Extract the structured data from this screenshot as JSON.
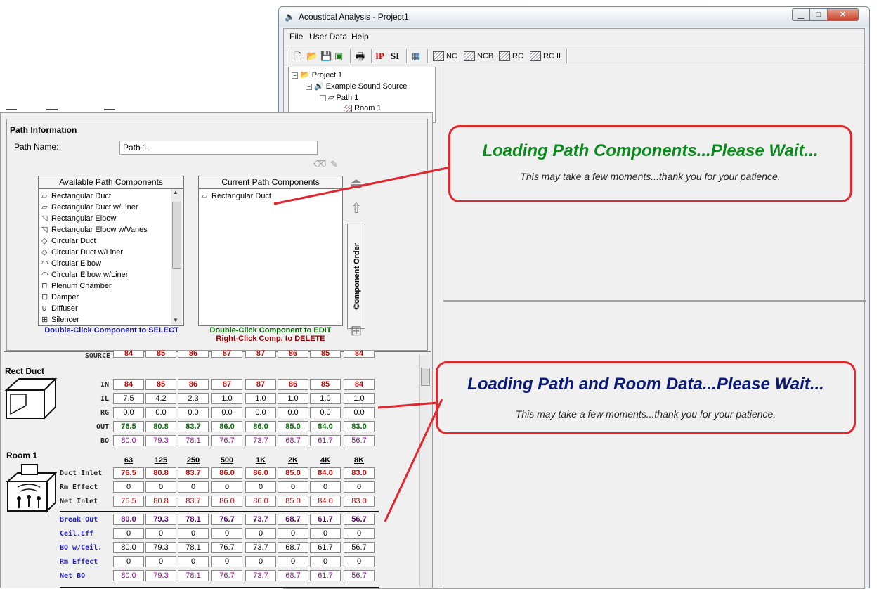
{
  "window": {
    "title": "Acoustical Analysis - Project1",
    "min_glyph": "▁",
    "max_glyph": "□",
    "close_glyph": "✕"
  },
  "menu": {
    "file": "File",
    "user_data": "User Data",
    "help": "Help"
  },
  "toolbar": {
    "ip": "IP",
    "si": "SI",
    "nc": "NC",
    "ncb": "NCB",
    "rc": "RC",
    "rc2": "RC II"
  },
  "tree": {
    "project": "Project 1",
    "source": "Example Sound Source",
    "path": "Path 1",
    "room": "Room 1"
  },
  "path_info": {
    "title": "Path Information",
    "name_label": "Path Name:",
    "name_value": "Path 1",
    "available_header": "Available Path Components",
    "current_header": "Current Path Components",
    "available_items": [
      "Rectangular Duct",
      "Rectangular Duct w/Liner",
      "Rectangular Elbow",
      "Rectangular Elbow w/Vanes",
      "Circular Duct",
      "Circular Duct w/Liner",
      "Circular Elbow",
      "Circular Elbow w/Liner",
      "Plenum Chamber",
      "Damper",
      "Diffuser",
      "Silencer"
    ],
    "current_items": [
      "Rectangular Duct"
    ],
    "hint_select": "Double-Click Component to SELECT",
    "hint_edit": "Double-Click Component to EDIT",
    "hint_delete": "Right-Click Comp. to DELETE",
    "order_label": "Component Order"
  },
  "data": {
    "source_label": "SOURCE",
    "source_values": [
      "84",
      "85",
      "86",
      "87",
      "87",
      "86",
      "85",
      "84"
    ],
    "rect_duct": {
      "title": "Rect Duct",
      "rows": [
        {
          "label": "IN",
          "values": [
            "84",
            "85",
            "86",
            "87",
            "87",
            "86",
            "85",
            "84"
          ]
        },
        {
          "label": "IL",
          "values": [
            "7.5",
            "4.2",
            "2.3",
            "1.0",
            "1.0",
            "1.0",
            "1.0",
            "1.0"
          ]
        },
        {
          "label": "RG",
          "values": [
            "0.0",
            "0.0",
            "0.0",
            "0.0",
            "0.0",
            "0.0",
            "0.0",
            "0.0"
          ]
        },
        {
          "label": "OUT",
          "values": [
            "76.5",
            "80.8",
            "83.7",
            "86.0",
            "86.0",
            "85.0",
            "84.0",
            "83.0"
          ]
        },
        {
          "label": "BO",
          "values": [
            "80.0",
            "79.3",
            "78.1",
            "76.7",
            "73.7",
            "68.7",
            "61.7",
            "56.7"
          ]
        }
      ]
    },
    "room": {
      "title": "Room 1",
      "bands": [
        "63",
        "125",
        "250",
        "500",
        "1K",
        "2K",
        "4K",
        "8K"
      ],
      "rows": [
        {
          "label": "Duct Inlet",
          "values": [
            "76.5",
            "80.8",
            "83.7",
            "86.0",
            "86.0",
            "85.0",
            "84.0",
            "83.0"
          ]
        },
        {
          "label": "Rm Effect",
          "values": [
            "0",
            "0",
            "0",
            "0",
            "0",
            "0",
            "0",
            "0"
          ]
        },
        {
          "label": "Net Inlet",
          "values": [
            "76.5",
            "80.8",
            "83.7",
            "86.0",
            "86.0",
            "85.0",
            "84.0",
            "83.0"
          ]
        },
        {
          "label": "Break Out",
          "values": [
            "80.0",
            "79.3",
            "78.1",
            "76.7",
            "73.7",
            "68.7",
            "61.7",
            "56.7"
          ]
        },
        {
          "label": "Ceil.Eff",
          "values": [
            "0",
            "0",
            "0",
            "0",
            "0",
            "0",
            "0",
            "0"
          ]
        },
        {
          "label": "BO w/Ceil.",
          "values": [
            "80.0",
            "79.3",
            "78.1",
            "76.7",
            "73.7",
            "68.7",
            "61.7",
            "56.7"
          ]
        },
        {
          "label": "Rm Effect",
          "values": [
            "0",
            "0",
            "0",
            "0",
            "0",
            "0",
            "0",
            "0"
          ]
        },
        {
          "label": "Net BO",
          "values": [
            "80.0",
            "79.3",
            "78.1",
            "76.7",
            "73.7",
            "68.7",
            "61.7",
            "56.7"
          ]
        }
      ]
    }
  },
  "callouts": {
    "path_title": "Loading Path Components...Please Wait...",
    "path_sub": "This may take a few moments...thank you for your patience.",
    "room_title": "Loading Path and Room Data...Please Wait...",
    "room_sub": "This may take a few moments...thank you for your patience."
  },
  "colors": {
    "callout_border": "#e0262e",
    "path_title": "#0a8a1a",
    "room_title": "#0a1a7a",
    "red_values": "#c80000",
    "green_values": "#007000",
    "purple_values": "#a000a0",
    "dark_purple": "#5a0070",
    "blue_labels": "#2020c0"
  }
}
